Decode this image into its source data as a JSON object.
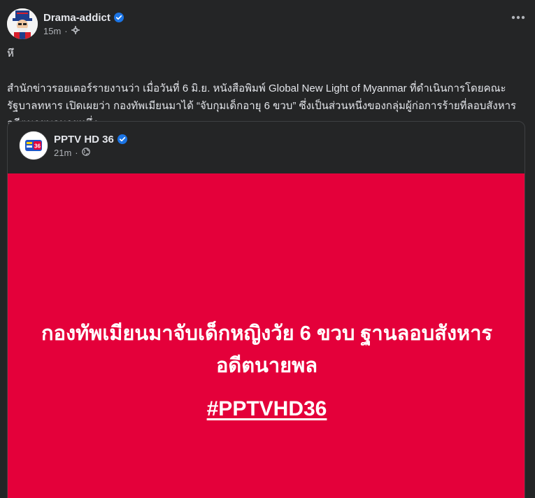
{
  "post": {
    "author": "Drama-addict",
    "time": "15m",
    "text": "หึ\n\nสำนักข่าวรอยเตอร์รายงานว่า เมื่อวันที่ 6 มิ.ย. หนังสือพิมพ์ Global New Light of Myanmar ที่ดำเนินการโดยคณะรัฐบาลทหาร เปิดเผยว่า กองทัพเมียนมาได้ “จับกุมเด็กอายุ 6 ขวบ” ซึ่งเป็นส่วนหนึ่งของกลุ่มผู้ก่อการร้ายที่ลอบสังหารอดีตนายพลนายหนึ่ง"
  },
  "shared": {
    "page_name": "PPTV HD 36",
    "time": "21m",
    "headline": "กองทัพเมียนมาจับเด็กหญิงวัย 6 ขวบ ฐานลอบสังหารอดีตนายพล",
    "hashtag": "#PPTVHD36",
    "logo_text": "36"
  },
  "icons": {
    "verified": "verified-badge-icon",
    "audience_self": "gear-icon",
    "audience_public": "globe-icon",
    "more": "more-options-icon"
  },
  "colors": {
    "background": "#242526",
    "text_primary": "#e4e6eb",
    "text_secondary": "#b0b3b8",
    "verified": "#1b74e4",
    "media_background": "#e4003a"
  }
}
